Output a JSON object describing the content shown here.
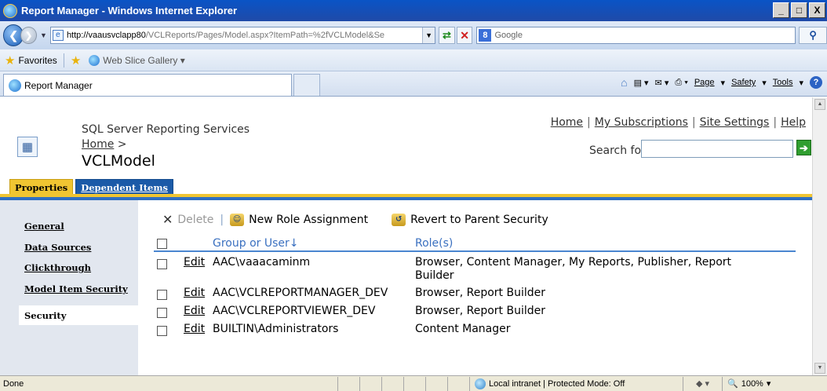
{
  "window": {
    "title": "Report Manager - Windows Internet Explorer",
    "buttons": [
      "_",
      "□",
      "X"
    ]
  },
  "addressbar": {
    "url_host": "http://vaausvclapp80",
    "url_path": "/VCLReports/Pages/Model.aspx?ItemPath=%2fVCLModel&Se",
    "search_placeholder": "Google"
  },
  "favorites": {
    "label": "Favorites",
    "web_slice": "Web Slice Gallery ▾"
  },
  "tab": {
    "label": "Report Manager"
  },
  "commandbar": {
    "page": "Page",
    "safety": "Safety",
    "tools": "Tools"
  },
  "header": {
    "product": "SQL Server Reporting Services",
    "breadcrumb_home": "Home",
    "breadcrumb_sep": ">",
    "title": "VCLModel",
    "links": [
      "Home",
      "My Subscriptions",
      "Site Settings",
      "Help"
    ],
    "search_label": "Search for:"
  },
  "tabs": {
    "properties": "Properties",
    "dependent": "Dependent Items"
  },
  "leftnav": [
    "General",
    "Data Sources",
    "Clickthrough",
    "Model Item Security",
    "Security"
  ],
  "toolbar": {
    "delete": "Delete",
    "new_role": "New Role Assignment",
    "revert": "Revert to Parent Security"
  },
  "grid": {
    "col_user": "Group or User↓",
    "col_role": "Role(s)",
    "edit_label": "Edit",
    "rows": [
      {
        "user": "AAC\\vaaacaminm",
        "role": "Browser, Content Manager, My Reports, Publisher, Report",
        "role2": "Builder"
      },
      {
        "user": "AAC\\VCLREPORTMANAGER_DEV",
        "role": "Browser, Report Builder",
        "role2": ""
      },
      {
        "user": "AAC\\VCLREPORTVIEWER_DEV",
        "role": "Browser, Report Builder",
        "role2": ""
      },
      {
        "user": "BUILTIN\\Administrators",
        "role": "Content Manager",
        "role2": ""
      }
    ]
  },
  "status": {
    "left": "Done",
    "zone": "Local intranet | Protected Mode: Off",
    "zoom": "100%"
  }
}
